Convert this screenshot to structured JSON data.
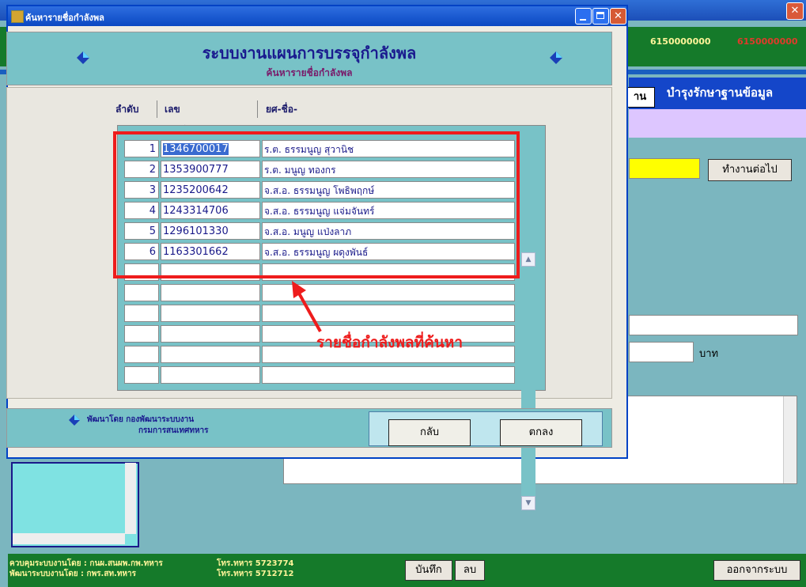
{
  "background_app": {
    "numbers": [
      "6150000000",
      "6150000000"
    ],
    "tab_label": "าน",
    "tab_title": "บำรุงรักษาฐานข้อมูล",
    "continue_button": "ทำงานต่อไป",
    "currency_unit": "บาท",
    "footer": {
      "line1": "ควบคุมระบบงานโดย : กนผ.สนผพ.กพ.ทหาร",
      "line2": "พัฒนาระบบงานโดย : กพร.สท.ทหาร",
      "phone1": "โทร.ทหาร 5723774",
      "phone2": "โทร.ทหาร 5712712",
      "save_label": "บันทึก",
      "delete_label": "ลบ",
      "exit_label": "ออกจากระบบ"
    }
  },
  "dialog": {
    "title": "ค้นหารายชื่อกำลังพล",
    "header_title": "ระบบงานแผนการบรรจุกำลังพล",
    "header_subtitle": "ค้นหารายชื่อกำลังพล",
    "columns": [
      "ลำดับ",
      "เลขประจำตัว",
      "ยศ-ชื่อ-นามสกุล"
    ],
    "rows": [
      {
        "no": "1",
        "id": "1346700017",
        "name": "ร.ต. ธรรมนูญ สุวานิช"
      },
      {
        "no": "2",
        "id": "1353900777",
        "name": "ร.ต. มนูญ ทองกร"
      },
      {
        "no": "3",
        "id": "1235200642",
        "name": "จ.ส.อ. ธรรมนูญ โพธิพฤกษ์"
      },
      {
        "no": "4",
        "id": "1243314706",
        "name": "จ.ส.อ. ธรรมนูญ แจ่มจันทร์"
      },
      {
        "no": "5",
        "id": "1296101330",
        "name": "จ.ส.อ. มนูญ แป่งลาภ"
      },
      {
        "no": "6",
        "id": "1163301662",
        "name": "จ.ส.อ. ธรรมนูญ ผดุงพันธ์"
      }
    ],
    "empty_rows": 6,
    "annotation": "รายชื่อกำลังพลที่ค้นหา",
    "developed_by_line1": "พัฒนาโดย กองพัฒนาระบบงาน",
    "developed_by_line2": "กรมการสนเทศทหาร",
    "back_button": "กลับ",
    "ok_button": "ตกลง"
  },
  "colors": {
    "accent_red": "#ee1c1c",
    "dialog_teal": "#78c2c7",
    "title_blue": "#1a1a8f"
  }
}
